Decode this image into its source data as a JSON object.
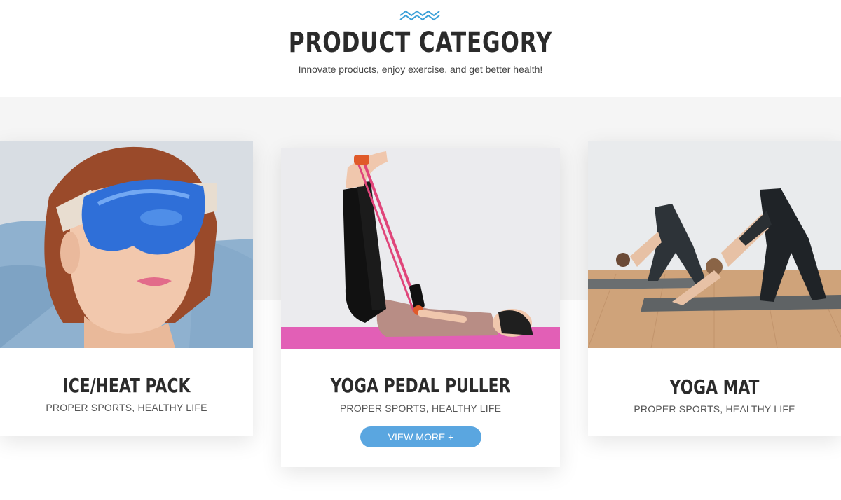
{
  "header": {
    "title": "PRODUCT CATEGORY",
    "subtitle": "Innovate products, enjoy exercise, and get better health!",
    "icon": "wave-icon",
    "accent_color": "#3aa0d8"
  },
  "cards": [
    {
      "title": "ICE/HEAT PACK",
      "subtitle": "PROPER SPORTS, HEALTHY LIFE",
      "image": "eye-mask-photo"
    },
    {
      "title": "YOGA PEDAL PULLER",
      "subtitle": "PROPER SPORTS, HEALTHY LIFE",
      "image": "pedal-puller-photo",
      "button_label": "VIEW MORE +"
    },
    {
      "title": "YOGA MAT",
      "subtitle": "PROPER SPORTS, HEALTHY LIFE",
      "image": "yoga-mat-photo"
    }
  ],
  "colors": {
    "button": "#5aa6e0",
    "band": "#f5f5f5",
    "title": "#2b2b2b"
  }
}
